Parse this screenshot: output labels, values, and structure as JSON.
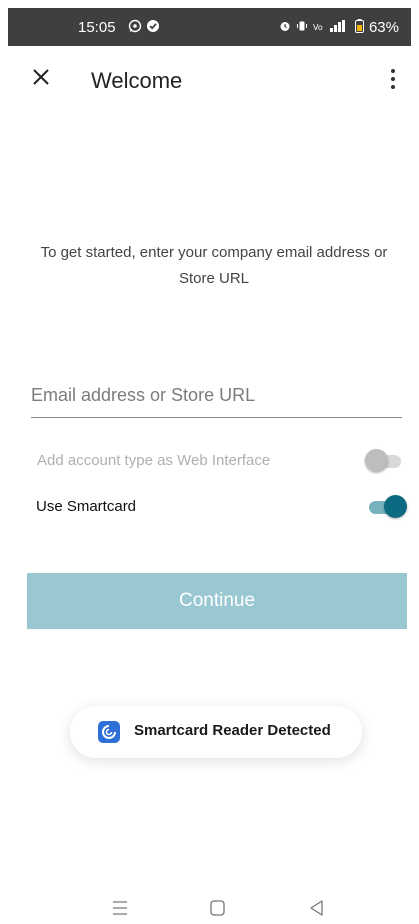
{
  "status_bar": {
    "time": "15:05",
    "battery": "63%",
    "icons_left": [
      "whatsapp-icon",
      "check-badge-icon"
    ],
    "icons_right": [
      "alarm-icon",
      "vibrate-icon",
      "volte-icon",
      "signal-icon",
      "battery-icon"
    ]
  },
  "toolbar": {
    "title": "Welcome",
    "close_icon": "close-icon",
    "more_icon": "more-vert-icon"
  },
  "intro_text": "To get started, enter your company email address or Store URL",
  "email_field": {
    "placeholder": "Email address or Store URL",
    "value": ""
  },
  "toggles": {
    "web_interface": {
      "label": "Add account type as Web Interface",
      "state": "off"
    },
    "smartcard": {
      "label": "Use Smartcard",
      "state": "on"
    }
  },
  "continue_button": "Continue",
  "toast": {
    "text": "Smartcard Reader Detected",
    "icon": "app-logo-icon"
  },
  "nav_bar": {
    "icons": [
      "recents-icon",
      "home-icon",
      "back-icon"
    ]
  },
  "colors": {
    "accent": "#0c6b80",
    "button_bg": "#9ac8d2",
    "status_bar_bg": "#3f3f3f"
  }
}
